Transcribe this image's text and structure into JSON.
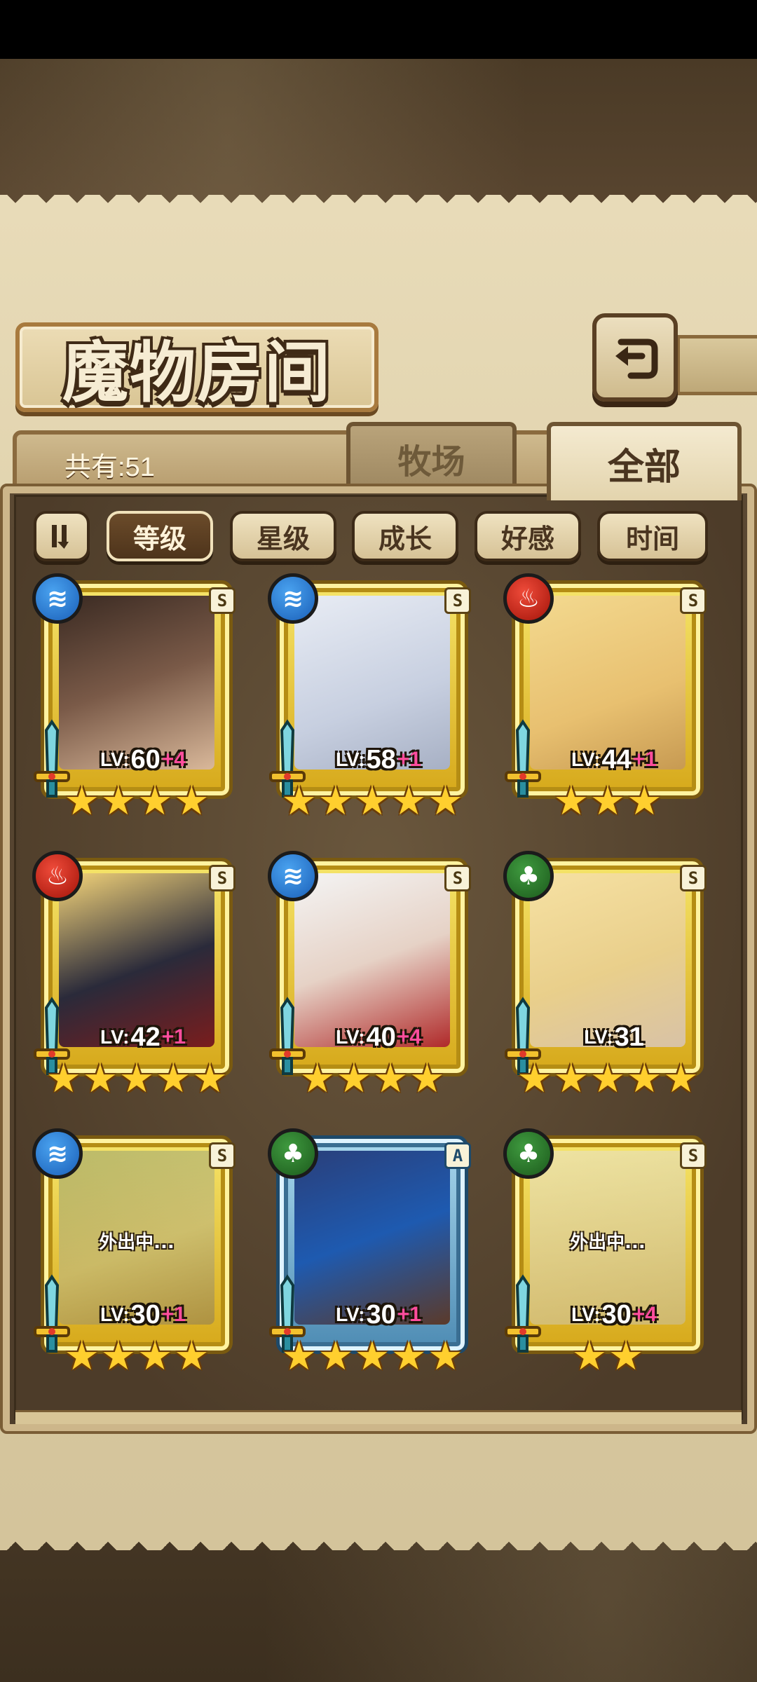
{
  "title": "魔物房间",
  "count_label": "共有:51",
  "tabs": [
    {
      "label": "牧场",
      "active": false
    },
    {
      "label": "全部",
      "active": true
    }
  ],
  "sort_toggle_icon": "sort-order-icon",
  "sort_buttons": [
    {
      "label": "等级",
      "active": true
    },
    {
      "label": "星级",
      "active": false
    },
    {
      "label": "成长",
      "active": false
    },
    {
      "label": "好感",
      "active": false
    },
    {
      "label": "时间",
      "active": false
    }
  ],
  "cards": [
    {
      "element": "water",
      "rank": "S",
      "level": "60",
      "plus": "+4",
      "stars": 4,
      "frame": "gold",
      "away": ""
    },
    {
      "element": "water",
      "rank": "S",
      "level": "58",
      "plus": "+1",
      "stars": 5,
      "frame": "gold",
      "away": ""
    },
    {
      "element": "fire",
      "rank": "S",
      "level": "44",
      "plus": "+1",
      "stars": 3,
      "frame": "gold",
      "away": ""
    },
    {
      "element": "fire",
      "rank": "S",
      "level": "42",
      "plus": "+1",
      "stars": 5,
      "frame": "gold",
      "away": ""
    },
    {
      "element": "water",
      "rank": "S",
      "level": "40",
      "plus": "+4",
      "stars": 4,
      "frame": "gold",
      "away": ""
    },
    {
      "element": "wood",
      "rank": "S",
      "level": "31",
      "plus": "",
      "stars": 5,
      "frame": "gold",
      "away": ""
    },
    {
      "element": "water",
      "rank": "S",
      "level": "30",
      "plus": "+1",
      "stars": 4,
      "frame": "gold",
      "away": "外出中..."
    },
    {
      "element": "wood",
      "rank": "A",
      "level": "30",
      "plus": "+1",
      "stars": 5,
      "frame": "blue",
      "away": ""
    },
    {
      "element": "wood",
      "rank": "S",
      "level": "30",
      "plus": "+4",
      "stars": 2,
      "frame": "gold",
      "away": "外出中..."
    }
  ],
  "lv_prefix": "LV:",
  "colors": {
    "water": "#1a5fb8",
    "fire": "#a31409",
    "wood": "#1c5a1c",
    "gold_frame": "#d6a81a",
    "blue_frame": "#4d8bb3",
    "plus": "#ff4d9d"
  }
}
